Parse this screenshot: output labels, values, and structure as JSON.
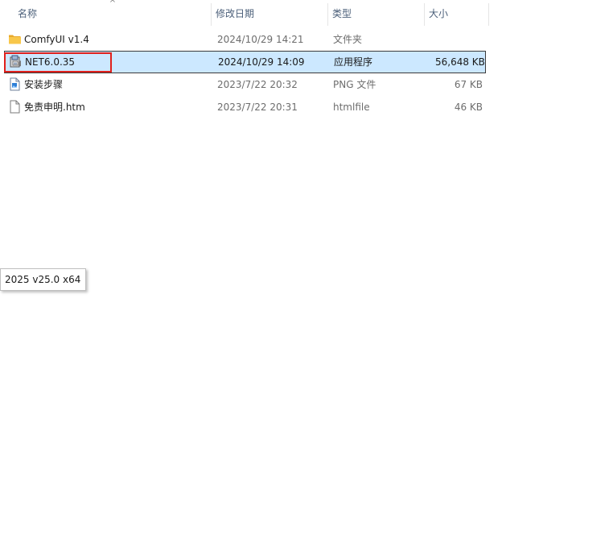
{
  "columns": {
    "name": "名称",
    "date": "修改日期",
    "type": "类型",
    "size": "大小"
  },
  "files": [
    {
      "name": "ComfyUI v1.4",
      "date": "2024/10/29 14:21",
      "type": "文件夹",
      "size": "",
      "icon": "folder-icon",
      "selected": false
    },
    {
      "name": "NET6.0.35",
      "date": "2024/10/29 14:09",
      "type": "应用程序",
      "size": "56,648 KB",
      "icon": "installer-icon",
      "selected": true
    },
    {
      "name": "安装步骤",
      "date": "2023/7/22 20:32",
      "type": "PNG 文件",
      "size": "67 KB",
      "icon": "image-file-icon",
      "selected": false
    },
    {
      "name": "免责申明.htm",
      "date": "2023/7/22 20:31",
      "type": "htmlfile",
      "size": "46 KB",
      "icon": "document-file-icon",
      "selected": false
    }
  ],
  "tooltip": {
    "text": "2025 v25.0 x64"
  },
  "colors": {
    "selection_bg": "#cce8ff",
    "highlight_border": "#e0201c",
    "header_text": "#4c607a",
    "folder": "#f8c74a"
  }
}
